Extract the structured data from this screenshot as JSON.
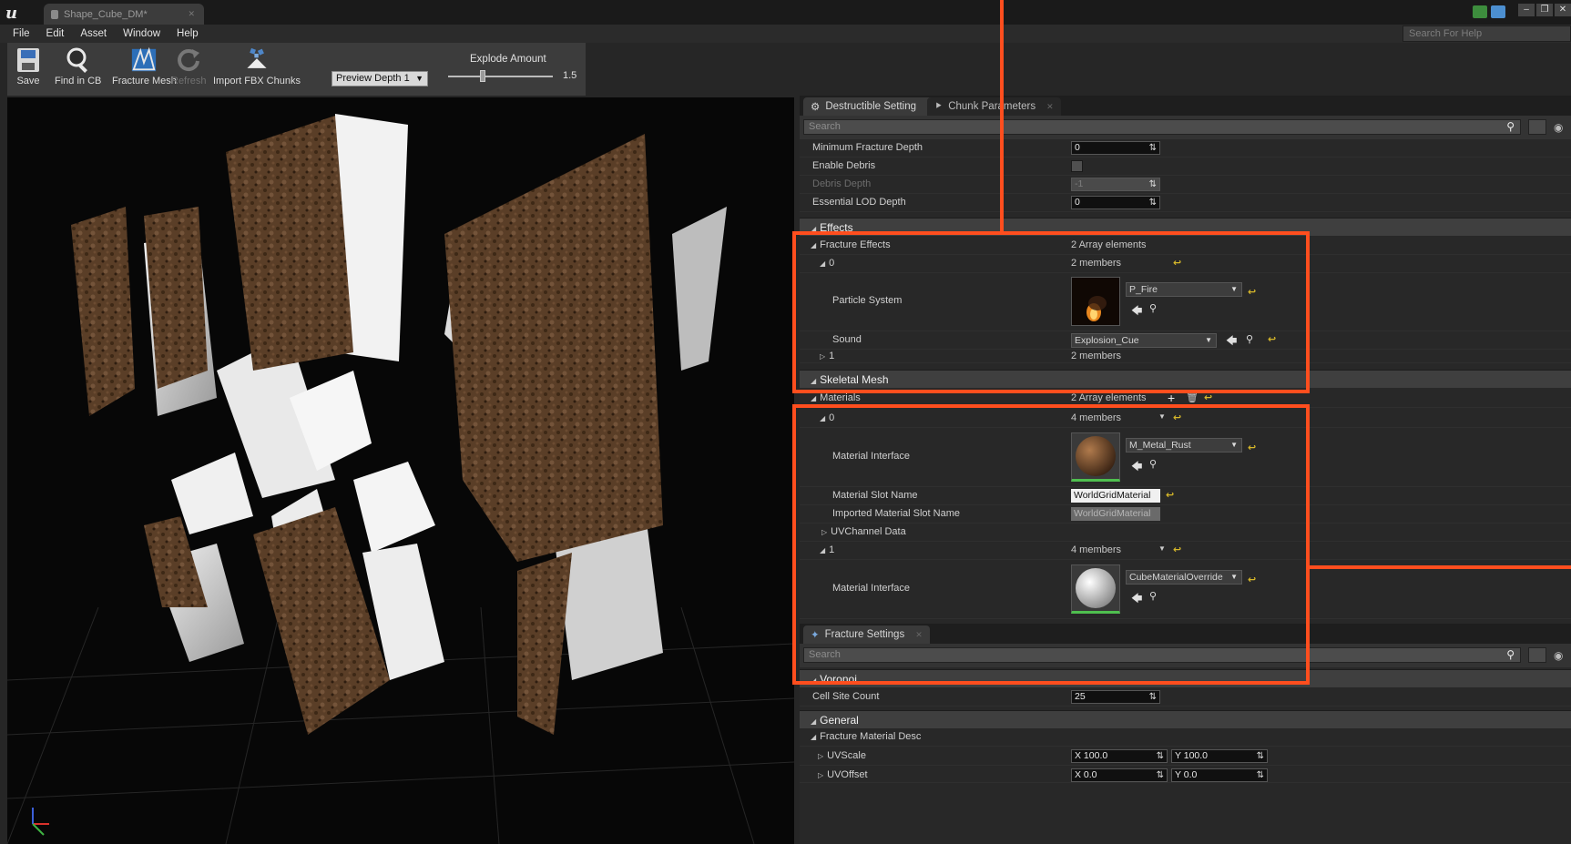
{
  "window": {
    "tab_title": "Shape_Cube_DM*"
  },
  "menu": [
    "File",
    "Edit",
    "Asset",
    "Window",
    "Help"
  ],
  "help_search_placeholder": "Search For Help",
  "toolbar": {
    "buttons": [
      {
        "label": "Save",
        "icon": "save-icon"
      },
      {
        "label": "Find in CB",
        "icon": "magnifier-icon"
      },
      {
        "label": "Fracture Mesh",
        "icon": "fracture-mesh-icon"
      },
      {
        "label": "Refresh",
        "icon": "refresh-icon"
      },
      {
        "label": "Import FBX Chunks",
        "icon": "import-chunks-icon"
      }
    ],
    "preview_depth": "Preview Depth 1",
    "explode_label": "Explode Amount",
    "explode_value": "1.5"
  },
  "panel_top": {
    "tabs": [
      "Destructible Setting",
      "Chunk Parameters"
    ],
    "search_placeholder": "Search",
    "rows": [
      {
        "label": "Minimum Fracture Depth",
        "value": "0"
      },
      {
        "label": "Enable Debris"
      },
      {
        "label": "Debris Depth",
        "value": "-1"
      },
      {
        "label": "Essential LOD Depth",
        "value": "0"
      }
    ],
    "effects": {
      "title": "Effects",
      "fracture_effects": {
        "label": "Fracture Effects",
        "value": "2 Array elements"
      },
      "item0": {
        "label": "0",
        "value": "2 members"
      },
      "particle": {
        "label": "Particle System",
        "asset": "P_Fire"
      },
      "sound": {
        "label": "Sound",
        "asset": "Explosion_Cue"
      },
      "item1": {
        "label": "1",
        "value": "2 members"
      }
    },
    "skeletal": {
      "title": "Skeletal Mesh",
      "materials": {
        "label": "Materials",
        "value": "2 Array elements"
      },
      "item0": {
        "label": "0",
        "value": "4 members"
      },
      "mat_interface0": {
        "label": "Material Interface",
        "asset": "M_Metal_Rust"
      },
      "slot_name": {
        "label": "Material Slot Name",
        "value": "WorldGridMaterial"
      },
      "imported_slot": {
        "label": "Imported Material Slot Name",
        "value": "WorldGridMaterial"
      },
      "uv_channel": {
        "label": "UVChannel Data"
      },
      "item1": {
        "label": "1",
        "value": "4 members"
      },
      "mat_interface1": {
        "label": "Material Interface",
        "asset": "CubeMaterialOverride"
      }
    }
  },
  "panel_bottom": {
    "tab": "Fracture Settings",
    "search_placeholder": "Search",
    "voronoi": {
      "title": "Voronoi",
      "cell_site_count": {
        "label": "Cell Site Count",
        "value": "25"
      }
    },
    "general": {
      "title": "General",
      "fracture_material_desc": "Fracture Material Desc",
      "uvscale": {
        "label": "UVScale",
        "x": "X 100.0",
        "y": "Y 100.0"
      },
      "uvoffset": {
        "label": "UVOffset",
        "x": "X 0.0",
        "y": "Y 0.0"
      }
    }
  },
  "colors": {
    "highlight": "#ff4e1e",
    "reset_arrow": "#d6b72a"
  }
}
